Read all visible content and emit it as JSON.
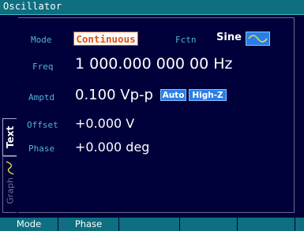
{
  "window": {
    "title": "Oscillator"
  },
  "side_tabs": [
    {
      "label": "Text"
    },
    {
      "label": "Graph"
    }
  ],
  "settings": {
    "mode": {
      "label": "Mode",
      "value": "Continuous"
    },
    "function": {
      "label": "Fctn",
      "value": "Sine",
      "icon": "sine-wave-icon"
    },
    "frequency": {
      "label": "Freq",
      "value": "1 000.000 000 00 Hz"
    },
    "amplitude": {
      "label": "Amptd",
      "value": "0.100 Vp-p",
      "badges": [
        "Auto",
        "High-Z"
      ]
    },
    "offset": {
      "label": "Offset",
      "value": "+0.000 V"
    },
    "phase": {
      "label": "Phase",
      "value": "+0.000 deg"
    }
  },
  "softkeys": [
    {
      "label": "Mode"
    },
    {
      "label": "Phase"
    },
    {
      "label": ""
    },
    {
      "label": ""
    },
    {
      "label": ""
    },
    {
      "label": ""
    }
  ],
  "colors": {
    "background": "#00003a",
    "title_bar": "#0e6f80",
    "label_text": "#4fb4d8",
    "mode_highlight": "#e05010",
    "badge": "#2a7ee8"
  }
}
